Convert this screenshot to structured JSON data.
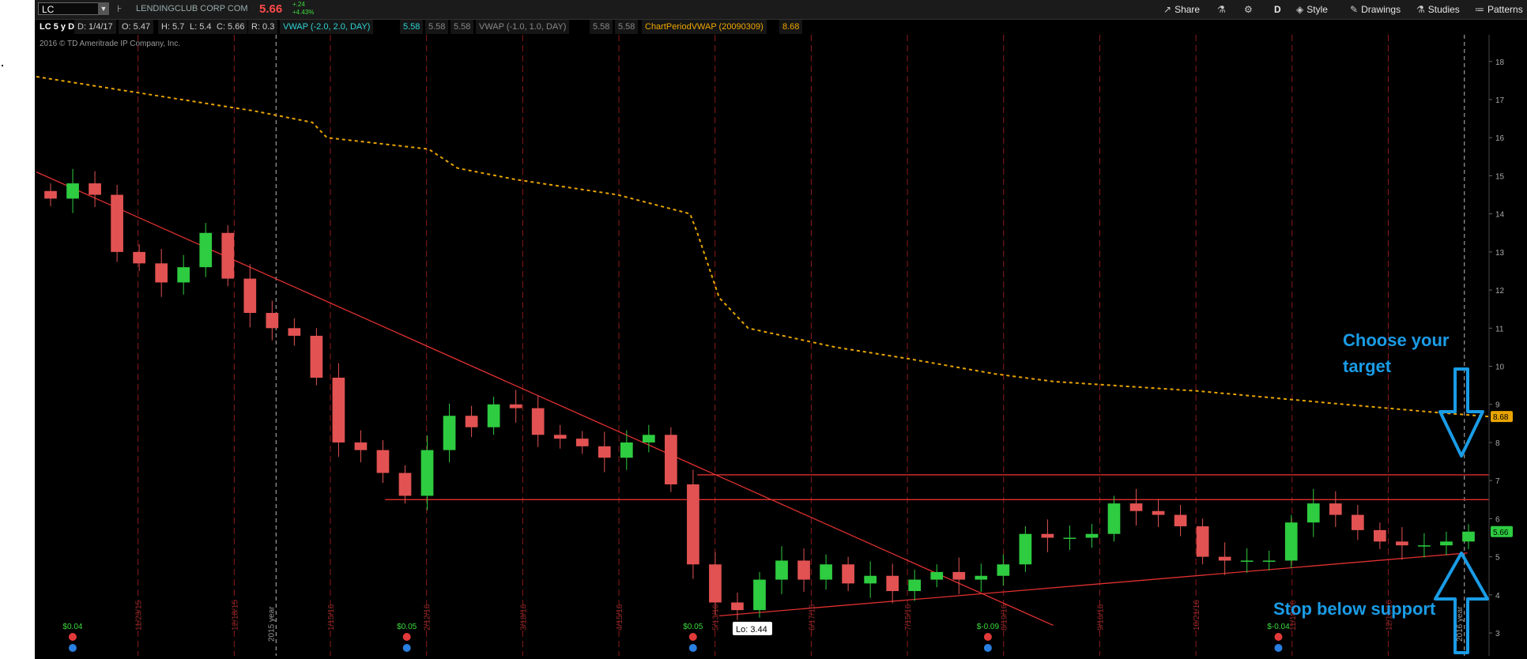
{
  "toolbar": {
    "symbol": "LC",
    "company": "LENDINGCLUB CORP COM",
    "last_price": "5.66",
    "change_abs": "+.24",
    "change_pct": "+4.43%",
    "buttons": [
      {
        "label": "Share",
        "icon": "share-icon"
      },
      {
        "label": "",
        "icon": "flask-icon"
      },
      {
        "label": "",
        "icon": "gear-icon"
      },
      {
        "label": "D",
        "icon": ""
      },
      {
        "label": "Style",
        "icon": "style-icon"
      },
      {
        "label": "Drawings",
        "icon": "pencil-icon"
      },
      {
        "label": "Studies",
        "icon": "studies-icon"
      },
      {
        "label": "Patterns",
        "icon": "patterns-icon"
      }
    ]
  },
  "info_bar": {
    "timeframe": "LC 5 y D",
    "date": "D: 1/4/17",
    "open": "O: 5.47",
    "high": "H: 5.7",
    "low": "L: 5.4",
    "close": "C: 5.66",
    "range": "R: 0.3",
    "vwap1_label": "VWAP (-2.0, 2.0, DAY)",
    "vwap1_v1": "5.58",
    "vwap1_v2": "5.58",
    "vwap1_v3": "5.58",
    "vwap2_label": "VWAP (-1.0, 1.0, DAY)",
    "vwap2_v1": "5.58",
    "vwap2_v2": "5.58",
    "cpvwap_label": "ChartPeriodVWAP (20090309)",
    "cpvwap_value": "8.68"
  },
  "copyright": "2016 © TD Ameritrade IP Company, Inc.",
  "colors": {
    "background": "#000000",
    "up_candle": "#2ecc40",
    "down_candle": "#e25252",
    "vwap_dotted": "#e8a400",
    "trendline": "#e03030",
    "annotation": "#1a9ce6",
    "earnings_green": "#3ddc3d",
    "earnings_red": "#ff4a4a"
  },
  "annotations": {
    "target_line1": "Choose your",
    "target_line2": "target",
    "stop_text": "Stop below support"
  },
  "chart_data": {
    "type": "candlestick",
    "title": "LC 5 y D",
    "ylim": [
      2.4,
      18.7
    ],
    "y_ticks": [
      3,
      4,
      5,
      6,
      7,
      8,
      9,
      10,
      11,
      12,
      13,
      14,
      15,
      16,
      17,
      18
    ],
    "y_tick_labels": [
      "3",
      "4",
      "5",
      "6",
      "7",
      "8",
      "9",
      "10",
      "11",
      "12",
      "13",
      "14",
      "15",
      "16",
      "17",
      "18"
    ],
    "price_markers": [
      {
        "label": "8.68",
        "value": 8.68,
        "color": "#e8a400"
      },
      {
        "label": "5.66",
        "value": 5.66,
        "color": "#2ecc40"
      }
    ],
    "x_date_labels": [
      "11/23/15",
      "12/18/15",
      "1/15/16",
      "2/12/16",
      "3/18/16",
      "4/15/16",
      "5/13/16",
      "6/17/16",
      "7/15/16",
      "8/19/16",
      "9/16/16",
      "10/21/16",
      "11/18/16",
      "12/16/16"
    ],
    "year_markers": [
      "2015 year",
      "2016 year"
    ],
    "low_label": "Lo: 3.44",
    "close_series": [
      [
        "10/26/15",
        14.4
      ],
      [
        "11/2/15",
        14.8
      ],
      [
        "11/9/15",
        14.5
      ],
      [
        "11/16/15",
        13.0
      ],
      [
        "11/23/15",
        12.7
      ],
      [
        "11/30/15",
        12.2
      ],
      [
        "12/7/15",
        12.6
      ],
      [
        "12/14/15",
        13.5
      ],
      [
        "12/18/15",
        12.3
      ],
      [
        "12/28/15",
        11.4
      ],
      [
        "1/4/16",
        11.0
      ],
      [
        "1/11/16",
        10.8
      ],
      [
        "1/15/16",
        9.7
      ],
      [
        "1/22/16",
        8.0
      ],
      [
        "1/29/16",
        7.8
      ],
      [
        "2/5/16",
        7.2
      ],
      [
        "2/12/16",
        6.6
      ],
      [
        "2/19/16",
        7.8
      ],
      [
        "2/26/16",
        8.7
      ],
      [
        "3/4/16",
        8.4
      ],
      [
        "3/11/16",
        9.0
      ],
      [
        "3/18/16",
        8.9
      ],
      [
        "3/25/16",
        8.2
      ],
      [
        "4/1/16",
        8.1
      ],
      [
        "4/8/16",
        7.9
      ],
      [
        "4/15/16",
        7.6
      ],
      [
        "4/22/16",
        8.0
      ],
      [
        "4/29/16",
        8.2
      ],
      [
        "5/6/16",
        6.9
      ],
      [
        "5/10/16",
        4.8
      ],
      [
        "5/13/16",
        3.8
      ],
      [
        "5/20/16",
        3.6
      ],
      [
        "5/27/16",
        4.4
      ],
      [
        "6/3/16",
        4.9
      ],
      [
        "6/10/16",
        4.4
      ],
      [
        "6/17/16",
        4.8
      ],
      [
        "6/24/16",
        4.3
      ],
      [
        "7/1/16",
        4.5
      ],
      [
        "7/8/16",
        4.1
      ],
      [
        "7/15/16",
        4.4
      ],
      [
        "7/22/16",
        4.6
      ],
      [
        "7/29/16",
        4.4
      ],
      [
        "8/5/16",
        4.5
      ],
      [
        "8/12/16",
        4.8
      ],
      [
        "8/19/16",
        5.6
      ],
      [
        "8/26/16",
        5.5
      ],
      [
        "9/2/16",
        5.5
      ],
      [
        "9/9/16",
        5.6
      ],
      [
        "9/16/16",
        6.4
      ],
      [
        "9/23/16",
        6.2
      ],
      [
        "9/30/16",
        6.1
      ],
      [
        "10/7/16",
        5.8
      ],
      [
        "10/14/16",
        5.0
      ],
      [
        "10/21/16",
        4.9
      ],
      [
        "10/28/16",
        4.9
      ],
      [
        "11/4/16",
        4.9
      ],
      [
        "11/11/16",
        5.9
      ],
      [
        "11/18/16",
        6.4
      ],
      [
        "11/25/16",
        6.1
      ],
      [
        "12/2/16",
        5.7
      ],
      [
        "12/9/16",
        5.4
      ],
      [
        "12/16/16",
        5.3
      ],
      [
        "12/23/16",
        5.3
      ],
      [
        "12/30/16",
        5.4
      ],
      [
        "1/4/17",
        5.66
      ]
    ],
    "chart_period_vwap": [
      [
        0,
        17.6
      ],
      [
        0.05,
        17.3
      ],
      [
        0.1,
        17.0
      ],
      [
        0.15,
        16.7
      ],
      [
        0.19,
        16.4
      ],
      [
        0.2,
        16.0
      ],
      [
        0.27,
        15.7
      ],
      [
        0.29,
        15.2
      ],
      [
        0.33,
        14.9
      ],
      [
        0.4,
        14.5
      ],
      [
        0.45,
        14.0
      ],
      [
        0.455,
        13.5
      ],
      [
        0.47,
        11.8
      ],
      [
        0.49,
        11.0
      ],
      [
        0.55,
        10.5
      ],
      [
        0.6,
        10.2
      ],
      [
        0.66,
        9.8
      ],
      [
        0.7,
        9.6
      ],
      [
        0.8,
        9.35
      ],
      [
        0.9,
        9.0
      ],
      [
        0.96,
        8.8
      ],
      [
        1.0,
        8.68
      ]
    ],
    "trendlines": [
      {
        "name": "downtrend",
        "points": [
          [
            0.0,
            15.1
          ],
          [
            0.7,
            3.2
          ]
        ]
      },
      {
        "name": "support",
        "points": [
          [
            0.47,
            3.45
          ],
          [
            0.985,
            5.1
          ]
        ]
      },
      {
        "name": "resistance_upper",
        "value": 7.15,
        "from": 0.455,
        "to": 1.0
      },
      {
        "name": "resistance_lower",
        "value": 6.5,
        "from": 0.24,
        "to": 1.0
      }
    ],
    "earnings": [
      {
        "label": "$0.04",
        "color": "#3ddc3d",
        "pos": 0.025
      },
      {
        "label": "$0.05",
        "color": "#3ddc3d",
        "pos": 0.255
      },
      {
        "label": "$0.05",
        "color": "#3ddc3d",
        "pos": 0.452
      },
      {
        "label": "$-0.09",
        "color": "#3ddc3d",
        "pos": 0.655
      },
      {
        "label": "$-0.04",
        "color": "#3ddc3d",
        "pos": 0.855
      }
    ],
    "grid": false,
    "legend": "none"
  }
}
